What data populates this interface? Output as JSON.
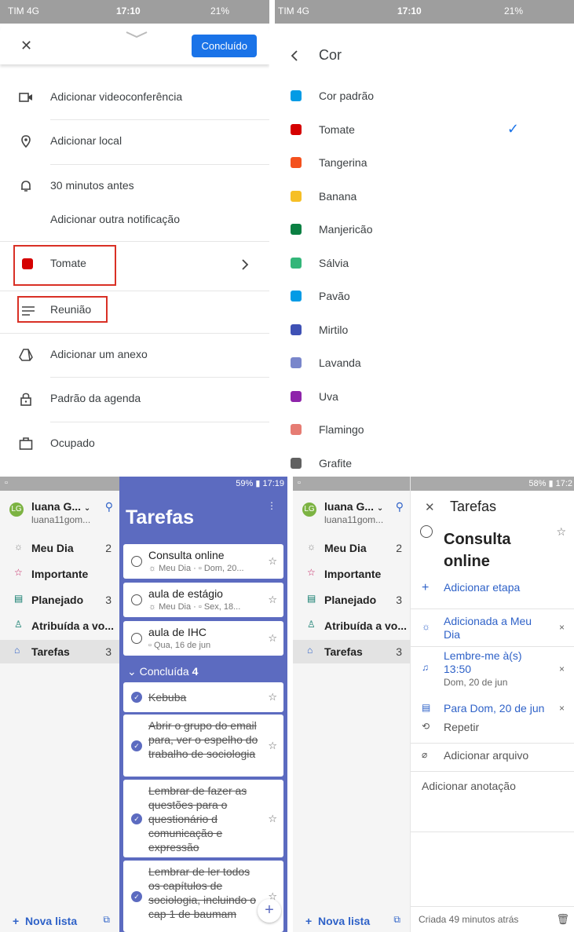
{
  "status1": {
    "carrier": "TIM 4G",
    "time": "17:10",
    "battery": "21%"
  },
  "status2": {
    "carrier": "TIM 4G",
    "time": "17:10",
    "battery": "21%"
  },
  "event": {
    "done_label": "Concluído",
    "rows": {
      "video": "Adicionar videoconferência",
      "location": "Adicionar local",
      "notification": "30 minutos antes",
      "other_notification": "Adicionar outra notificação",
      "color": "Tomate",
      "description": "Reunião",
      "attachment": "Adicionar um anexo",
      "visibility": "Padrão da agenda",
      "availability": "Ocupado"
    },
    "color_hex": "#d50000"
  },
  "color_picker": {
    "title": "Cor",
    "colors": [
      {
        "name": "Cor padrão",
        "hex": "#039be5"
      },
      {
        "name": "Tomate",
        "hex": "#d50000",
        "selected": true
      },
      {
        "name": "Tangerina",
        "hex": "#f4511e"
      },
      {
        "name": "Banana",
        "hex": "#f6bf26"
      },
      {
        "name": "Manjericão",
        "hex": "#0b8043"
      },
      {
        "name": "Sálvia",
        "hex": "#33b679"
      },
      {
        "name": "Pavão",
        "hex": "#039be5"
      },
      {
        "name": "Mirtilo",
        "hex": "#3f51b5"
      },
      {
        "name": "Lavanda",
        "hex": "#7986cb"
      },
      {
        "name": "Uva",
        "hex": "#8e24aa"
      },
      {
        "name": "Flamingo",
        "hex": "#e67c73"
      },
      {
        "name": "Grafite",
        "hex": "#616161"
      }
    ]
  },
  "todo": {
    "status_left": {
      "battery": "59%",
      "time": "17:19"
    },
    "status_right": {
      "battery": "58%",
      "time": "17:2"
    },
    "user": {
      "initials": "LG",
      "name": "luana G...",
      "email": "luana11gom..."
    },
    "nav": [
      {
        "icon": "☼",
        "label": "Meu Dia",
        "count": "2"
      },
      {
        "icon": "☆",
        "label": "Importante",
        "count": ""
      },
      {
        "icon": "▤",
        "label": "Planejado",
        "count": "3"
      },
      {
        "icon": "♙",
        "label": "Atribuída a vo...",
        "count": ""
      },
      {
        "icon": "⌂",
        "label": "Tarefas",
        "count": "3"
      }
    ],
    "new_list": "Nova lista",
    "list_title": "Tarefas",
    "tasks": [
      {
        "title": "Consulta online",
        "meta": "☼ Meu Dia · ▫ Dom, 20..."
      },
      {
        "title": "aula de estágio",
        "meta": "☼ Meu Dia · ▫ Sex, 18..."
      },
      {
        "title": "aula de IHC",
        "meta": "▫ Qua, 16 de jun"
      }
    ],
    "completed_label": "Concluída",
    "completed_count": "4",
    "completed": [
      "Kebuba",
      "Abrir o grupo do email para, ver o espelho do trabalho de sociologia",
      "Lembrar de fazer as questões para o questionário d comunicação e expressão",
      "Lembrar de ler todos os capítulos de sociologia, incluindo o cap 1 de baumam"
    ],
    "detail": {
      "header": "Tarefas",
      "title": "Consulta online",
      "add_step": "Adicionar etapa",
      "my_day": "Adicionada a Meu Dia",
      "reminder": "Lembre-me à(s) 13:50",
      "reminder_date": "Dom, 20 de jun",
      "due": "Para Dom, 20 de jun",
      "repeat": "Repetir",
      "add_file": "Adicionar arquivo",
      "add_note": "Adicionar anotação",
      "created": "Criada 49 minutos atrás"
    }
  }
}
